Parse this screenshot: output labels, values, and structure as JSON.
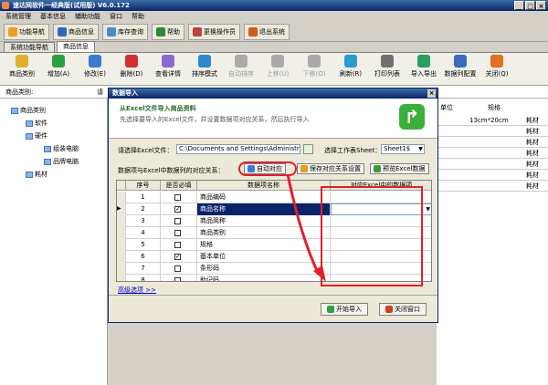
{
  "app": {
    "title": "速达网软件一经典版(试用版) V6.0.172",
    "win_min": "_",
    "win_max": "□",
    "win_close": "×"
  },
  "menu": [
    "系统管理",
    "基本信息",
    "辅助功能",
    "窗口",
    "帮助"
  ],
  "nav_buttons": [
    {
      "label": "功能导航",
      "color": "#e8a020"
    },
    {
      "label": "商品信息",
      "color": "#2a6ac0"
    },
    {
      "label": "库存查询",
      "color": "#4a8ad0"
    },
    {
      "label": "帮助",
      "color": "#2a8a3a"
    },
    {
      "label": "更换操作员",
      "color": "#c04040"
    },
    {
      "label": "退出系统",
      "color": "#d05a20"
    }
  ],
  "tabs": [
    {
      "label": "系统功能导航",
      "active": false
    },
    {
      "label": "商品信息",
      "active": true
    }
  ],
  "toolbar": [
    {
      "label": "商品类别",
      "color": "#e0b030",
      "disabled": false
    },
    {
      "label": "增加(A)",
      "color": "#2aa040",
      "disabled": false
    },
    {
      "label": "修改(E)",
      "color": "#3a7ad0",
      "disabled": false
    },
    {
      "label": "删除(D)",
      "color": "#d03030",
      "disabled": false
    },
    {
      "label": "查看详情",
      "color": "#8a6ad0",
      "disabled": false
    },
    {
      "label": "排序模式",
      "color": "#2a8ad0",
      "disabled": false
    },
    {
      "label": "自动排序",
      "color": "#aaaaaa",
      "disabled": true
    },
    {
      "label": "上移(U)",
      "color": "#aaaaaa",
      "disabled": true
    },
    {
      "label": "下移(O)",
      "color": "#aaaaaa",
      "disabled": true
    },
    {
      "label": "刷新(R)",
      "color": "#2a9ad0",
      "disabled": false
    },
    {
      "label": "打印列表",
      "color": "#707070",
      "disabled": false
    },
    {
      "label": "导入导出",
      "color": "#2aa060",
      "disabled": false
    },
    {
      "label": "数据列配置",
      "color": "#3a6ac0",
      "disabled": false
    },
    {
      "label": "关闭(Q)",
      "color": "#e07020",
      "disabled": false
    }
  ],
  "filterbar": {
    "label": "商品类别:",
    "label2": "请"
  },
  "tree": [
    {
      "label": "商品类别",
      "depth": 0
    },
    {
      "label": "软件",
      "depth": 1
    },
    {
      "label": "硬件",
      "depth": 1
    },
    {
      "label": "组装电脑",
      "depth": 2
    },
    {
      "label": "品牌电脑",
      "depth": 2
    },
    {
      "label": "耗材",
      "depth": 1
    }
  ],
  "right_grid": {
    "headers": [
      "单位",
      "规格"
    ],
    "rows": [
      {
        "spec": "13cm*20cm",
        "cat": "耗材"
      },
      {
        "spec": "",
        "cat": "耗材"
      },
      {
        "spec": "",
        "cat": "耗材"
      },
      {
        "spec": "",
        "cat": "耗材"
      },
      {
        "spec": "",
        "cat": "耗材"
      },
      {
        "spec": "",
        "cat": "耗材"
      },
      {
        "spec": "",
        "cat": "耗材"
      }
    ]
  },
  "dialog": {
    "title": "数据导入",
    "close": "×",
    "heading": "从Excel文件导入商品资料",
    "subheading": "先选择要导入的Excel文件，并设置数据项对应关系，然后执行导入",
    "file_label": "请选择Excel文件：",
    "file_value": "C:\\Documents and Settings\\Administrator",
    "sheet_label": "选择工作表Sheet：",
    "sheet_value": "Sheet1$",
    "map_label": "数据项与Excel中数据列的对应关系：",
    "auto_btn": "自动对应",
    "save_btn": "保存对应关系设置",
    "preview_btn": "预览Excel数据",
    "columns": {
      "no": "序号",
      "required": "是否必填",
      "name": "数据项名称",
      "excel": "对应Excel中的数据项"
    },
    "rows": [
      {
        "no": "1",
        "required": false,
        "name": "商品编码"
      },
      {
        "no": "2",
        "required": true,
        "name": "商品名称"
      },
      {
        "no": "3",
        "required": false,
        "name": "商品简称"
      },
      {
        "no": "4",
        "required": false,
        "name": "商品类别"
      },
      {
        "no": "5",
        "required": false,
        "name": "规格"
      },
      {
        "no": "6",
        "required": true,
        "name": "基本单位"
      },
      {
        "no": "7",
        "required": false,
        "name": "条形码"
      },
      {
        "no": "8",
        "required": false,
        "name": "助记码"
      }
    ],
    "advanced": "高级选项 >>",
    "start_btn": "开始导入",
    "close_btn": "关闭窗口"
  }
}
